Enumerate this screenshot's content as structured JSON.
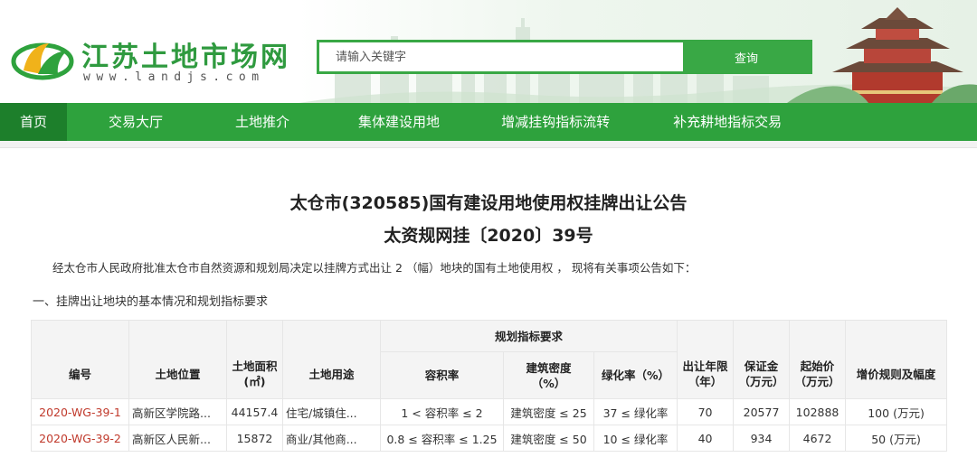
{
  "header": {
    "site_title": "江苏土地市场网",
    "site_url": "www.landjs.com",
    "search_placeholder": "请输入关键字",
    "search_button": "查询"
  },
  "nav": {
    "items": [
      {
        "label": "首页",
        "active": true
      },
      {
        "label": "交易大厅"
      },
      {
        "label": "土地推介"
      },
      {
        "label": "集体建设用地"
      },
      {
        "label": "增减挂钩指标流转"
      },
      {
        "label": "补充耕地指标交易"
      }
    ]
  },
  "article": {
    "title_line1": "太仓市(320585)国有建设用地使用权挂牌出让公告",
    "title_line2": "太资规网挂〔2020〕39号",
    "intro": "经太仓市人民政府批准太仓市自然资源和规划局决定以挂牌方式出让 2 （幅）地块的国有土地使用权 ， 现将有关事项公告如下：",
    "section_heading": "一、挂牌出让地块的基本情况和规划指标要求"
  },
  "table": {
    "headers": {
      "code": "编号",
      "location": "土地位置",
      "area": "土地面积\n(㎡)",
      "use": "土地用途",
      "planning_group": "规划指标要求",
      "far": "容积率",
      "density": "建筑密度\n（%）",
      "greening": "绿化率（%）",
      "term": "出让年限\n（年）",
      "deposit": "保证金\n（万元）",
      "start_price": "起始价\n（万元）",
      "increment": "增价规则及幅度"
    },
    "rows": [
      {
        "code": "2020-WG-39-1",
        "location": "高新区学院路...",
        "area": "44157.4",
        "use": "住宅/城镇住...",
        "far": "1 < 容积率 ≤ 2",
        "density": "建筑密度 ≤ 25",
        "greening": "37 ≤ 绿化率",
        "term": "70",
        "deposit": "20577",
        "start_price": "102888",
        "increment": "100 (万元)"
      },
      {
        "code": "2020-WG-39-2",
        "location": "高新区人民新...",
        "area": "15872",
        "use": "商业/其他商...",
        "far": "0.8 ≤ 容积率 ≤ 1.25",
        "density": "建筑密度 ≤ 50",
        "greening": "10 ≤ 绿化率",
        "term": "40",
        "deposit": "934",
        "start_price": "4672",
        "increment": "50 (万元)"
      }
    ]
  },
  "colors": {
    "brand_green": "#2ea23d",
    "nav_active": "#1d7f2b",
    "code_red": "#c0392b"
  }
}
